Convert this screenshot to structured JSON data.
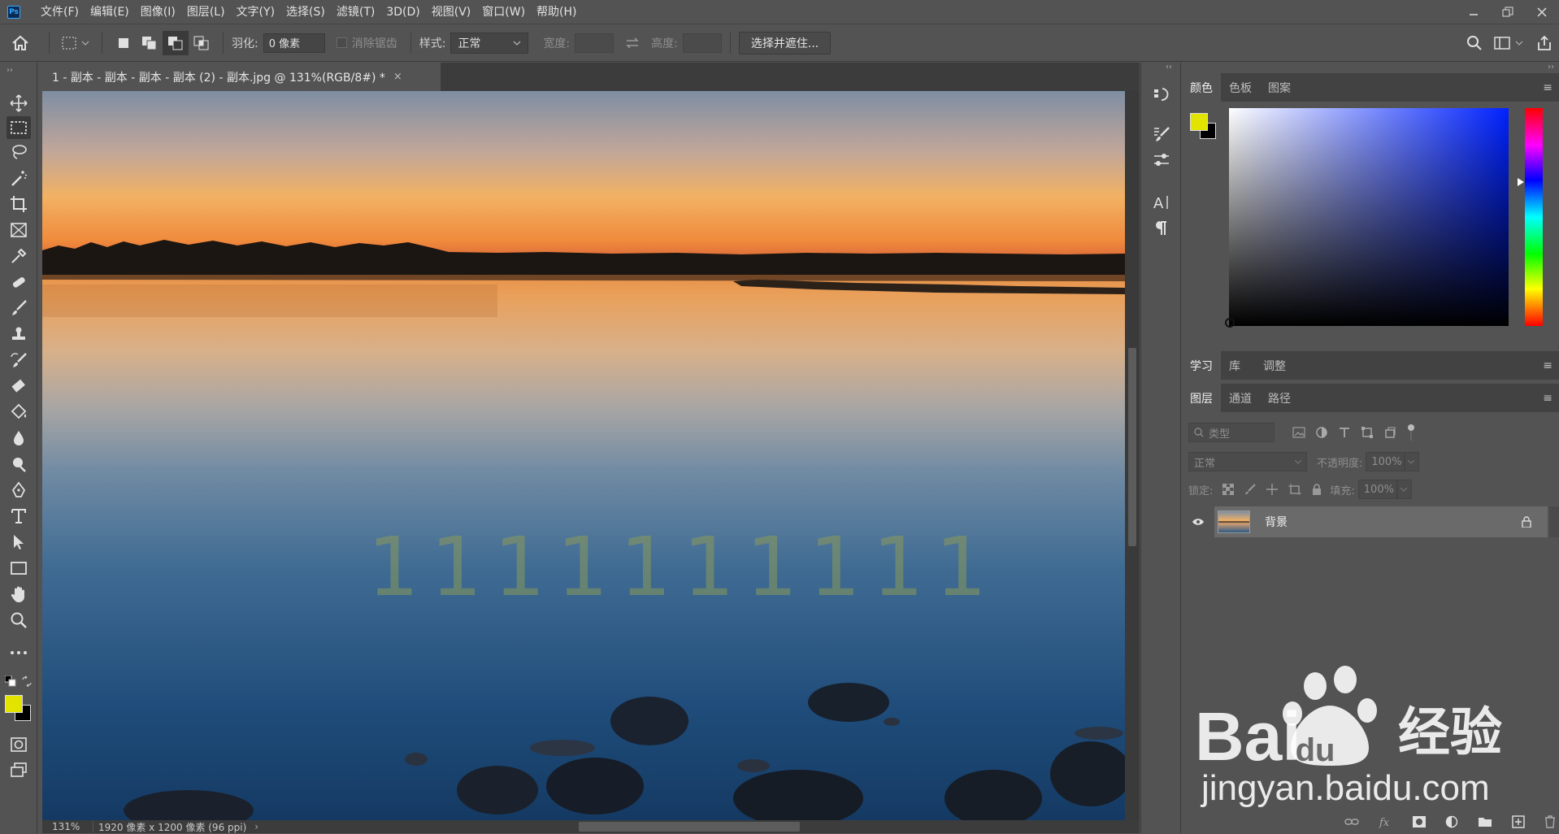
{
  "app": {
    "logo_text": "Ps"
  },
  "menu": {
    "items": [
      "文件(F)",
      "编辑(E)",
      "图像(I)",
      "图层(L)",
      "文字(Y)",
      "选择(S)",
      "滤镜(T)",
      "3D(D)",
      "视图(V)",
      "窗口(W)",
      "帮助(H)"
    ]
  },
  "options": {
    "feather_label": "羽化:",
    "feather_value": "0 像素",
    "antialias_label": "消除锯齿",
    "style_label": "样式:",
    "style_value": "正常",
    "width_label": "宽度:",
    "height_label": "高度:",
    "select_mask_button": "选择并遮住..."
  },
  "document": {
    "tab_title": "1 - 副本 - 副本 - 副本 - 副本 (2) - 副本.jpg @ 131%(RGB/8#) *",
    "tab_close": "×",
    "overlay_text": "1111111111",
    "zoom": "131%",
    "doc_info": "1920 像素 x 1200 像素 (96 ppi)"
  },
  "colors": {
    "foreground": "#e3e300",
    "background": "#000000",
    "picker_hue": "#0022ff"
  },
  "panels": {
    "color_tabs": [
      "颜色",
      "色板",
      "图案"
    ],
    "learn_tabs": [
      "学习",
      "库",
      "调整"
    ],
    "layers_tabs": [
      "图层",
      "通道",
      "路径"
    ],
    "filter_placeholder": "类型",
    "blend_mode": "正常",
    "opacity_label": "不透明度:",
    "opacity_value": "100%",
    "lock_label": "锁定:",
    "fill_label": "填充:",
    "fill_value": "100%",
    "layer_name": "背景"
  },
  "watermark": {
    "brand": "Bai",
    "brand_suffix": "经验",
    "url": "jingyan.baidu.com"
  }
}
